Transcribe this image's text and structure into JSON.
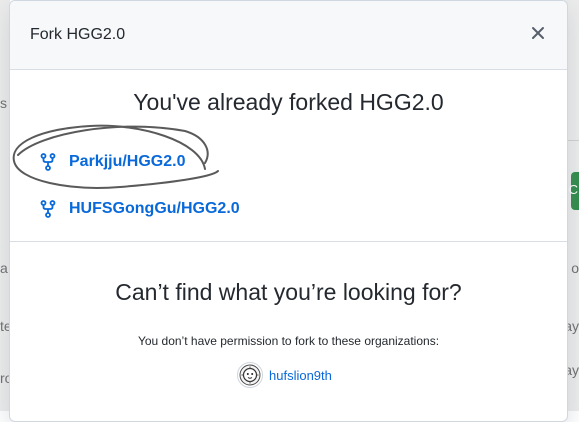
{
  "modal": {
    "title": "Fork HGG2.0",
    "close_icon": "close-icon"
  },
  "already_forked": {
    "heading": "You've already forked HGG2.0",
    "forks": [
      {
        "label": "Parkjju/HGG2.0",
        "icon": "repo-forked-icon"
      },
      {
        "label": "HUFSGongGu/HGG2.0",
        "icon": "repo-forked-icon"
      }
    ]
  },
  "cant_find": {
    "heading": "Can’t find what you’re looking for?",
    "permission_text": "You don’t have permission to fork to these organizations:",
    "organizations": [
      {
        "label": "hufslion9th",
        "icon": "org-avatar-icon"
      }
    ]
  },
  "background": {
    "left_chars": [
      "s",
      "a",
      "te",
      "ro"
    ],
    "right_chars": [
      "C",
      "o",
      "ay",
      "ay"
    ]
  },
  "colors": {
    "link": "#0969da",
    "text": "#24292f",
    "header_bg": "#f6f8fa",
    "border": "#d8dee4",
    "scribble": "#5a5a5a"
  }
}
